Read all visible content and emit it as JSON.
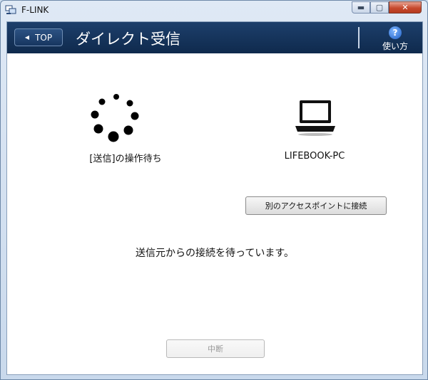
{
  "window": {
    "title": "F-LINK",
    "min_symbol": "▬",
    "max_symbol": "▢",
    "close_symbol": "✕"
  },
  "header": {
    "back_label": "TOP",
    "back_arrow": "◀",
    "title": "ダイレクト受信",
    "help_icon": "?",
    "help_label": "使い方"
  },
  "status": {
    "label": "[送信]の操作待ち",
    "icon": "loading-spinner"
  },
  "device": {
    "name": "LIFEBOOK-PC",
    "icon": "laptop-icon"
  },
  "buttons": {
    "other_ap": "別のアクセスポイントに接続",
    "stop": "中断"
  },
  "message": "送信元からの接続を待っています。",
  "colors": {
    "header_bg": "#12325a",
    "accent": "#1f5fc4",
    "close": "#c74a2e"
  }
}
